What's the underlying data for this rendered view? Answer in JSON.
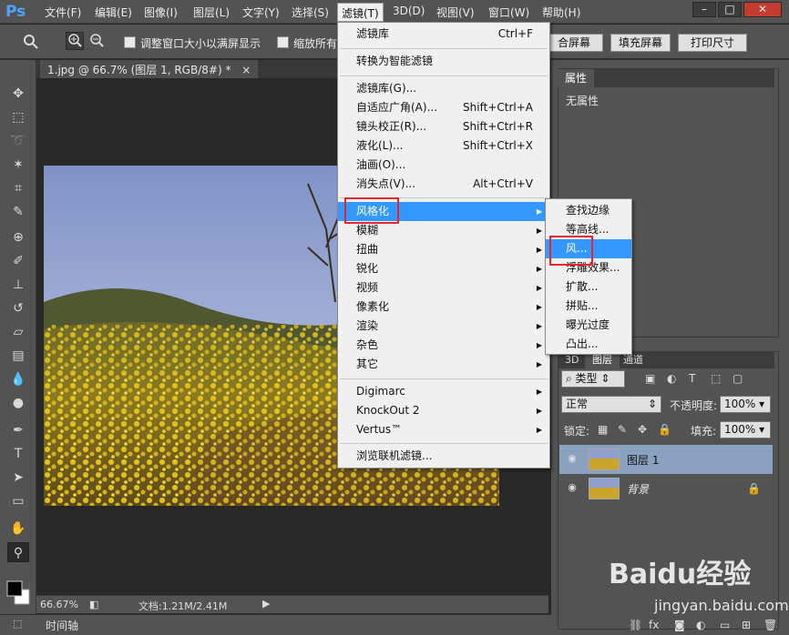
{
  "app": {
    "logo": "Ps"
  },
  "menubar": {
    "items": [
      {
        "label": "文件(F)"
      },
      {
        "label": "编辑(E)"
      },
      {
        "label": "图像(I)"
      },
      {
        "label": "图层(L)"
      },
      {
        "label": "文字(Y)"
      },
      {
        "label": "选择(S)"
      },
      {
        "label": "滤镜(T)"
      },
      {
        "label": "3D(D)"
      },
      {
        "label": "视图(V)"
      },
      {
        "label": "窗口(W)"
      },
      {
        "label": "帮助(H)"
      }
    ],
    "active_index": 6,
    "window_buttons": {
      "minimize": "–",
      "restore": "□",
      "close": "✕"
    }
  },
  "options": {
    "resize_windows_label": "调整窗口大小以满屏显示",
    "zoom_all_label": "缩放所有",
    "fit_screen_label": "合屏幕",
    "fill_screen_label": "填充屏幕",
    "print_size_label": "打印尺寸"
  },
  "document": {
    "tab_title": "1.jpg @ 66.7% (图层 1, RGB/8#) *",
    "tab_close": "×"
  },
  "status": {
    "zoom": "66.67%",
    "doc_info": "文档:1.21M/2.41M"
  },
  "timeline": {
    "label": "时间轴"
  },
  "filter_menu": {
    "items": [
      {
        "label": "滤镜库",
        "shortcut": "Ctrl+F"
      },
      {
        "label": "转换为智能滤镜"
      },
      {
        "label": "滤镜库(G)..."
      },
      {
        "label": "自适应广角(A)...",
        "shortcut": "Shift+Ctrl+A"
      },
      {
        "label": "镜头校正(R)...",
        "shortcut": "Shift+Ctrl+R"
      },
      {
        "label": "液化(L)...",
        "shortcut": "Shift+Ctrl+X"
      },
      {
        "label": "油画(O)..."
      },
      {
        "label": "消失点(V)...",
        "shortcut": "Alt+Ctrl+V"
      },
      {
        "label": "风格化"
      },
      {
        "label": "模糊"
      },
      {
        "label": "扭曲"
      },
      {
        "label": "锐化"
      },
      {
        "label": "视频"
      },
      {
        "label": "像素化"
      },
      {
        "label": "渲染"
      },
      {
        "label": "杂色"
      },
      {
        "label": "其它"
      },
      {
        "label": "Digimarc"
      },
      {
        "label": "KnockOut 2"
      },
      {
        "label": "Vertus™"
      },
      {
        "label": "浏览联机滤镜..."
      }
    ],
    "highlighted": "风格化"
  },
  "stylize_submenu": {
    "items": [
      {
        "label": "查找边缘"
      },
      {
        "label": "等高线..."
      },
      {
        "label": "风..."
      },
      {
        "label": "浮雕效果..."
      },
      {
        "label": "扩散..."
      },
      {
        "label": "拼贴..."
      },
      {
        "label": "曝光过度"
      },
      {
        "label": "凸出..."
      }
    ],
    "highlighted": "风..."
  },
  "properties_panel": {
    "tab": "属性",
    "content": "无属性"
  },
  "layers_panel": {
    "tabs": [
      "3D",
      "图层",
      "通道"
    ],
    "filter_kind": "类型",
    "blend_mode": "正常",
    "opacity_label": "不透明度:",
    "opacity_value": "100%",
    "lock_label": "锁定:",
    "fill_label": "填充:",
    "fill_value": "100%",
    "layers": [
      {
        "name": "图层 1",
        "selected": true
      },
      {
        "name": "背景",
        "locked": true
      }
    ]
  },
  "watermark": {
    "brand": "Baidu经验",
    "url": "jingyan.baidu.com"
  },
  "colors": {
    "accent": "#3399ff",
    "highlight_box": "#e8262b",
    "ui_panel": "#535353",
    "canvas_bg": "#282828"
  }
}
